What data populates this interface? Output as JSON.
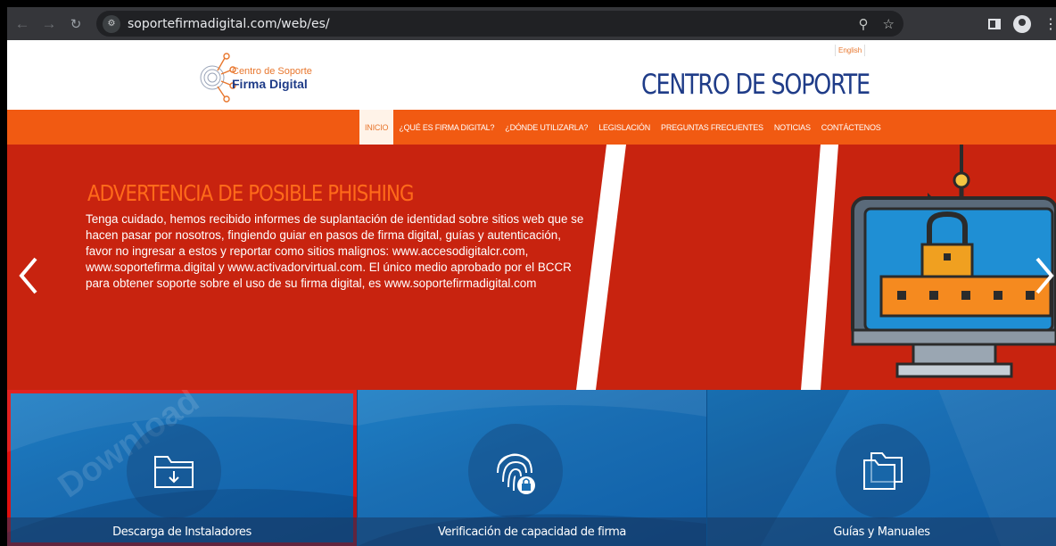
{
  "browser": {
    "url": "soportefirmadigital.com/web/es/",
    "icons": [
      "back-icon",
      "forward-icon",
      "reload-icon",
      "site-info-icon",
      "zoom-icon",
      "bookmark-star-icon",
      "side-panel-icon",
      "profile-icon",
      "menu-icon"
    ]
  },
  "header": {
    "logo_line1": "Centro de Soporte",
    "logo_line2": "Firma Digital",
    "lang_link": "English",
    "title": "CENTRO DE SOPORTE"
  },
  "nav": {
    "items": [
      {
        "label": "INICIO",
        "active": true
      },
      {
        "label": "¿QUÉ ES FIRMA DIGITAL?",
        "active": false
      },
      {
        "label": "¿DÓNDE UTILIZARLA?",
        "active": false
      },
      {
        "label": "LEGISLACIÓN",
        "active": false
      },
      {
        "label": "PREGUNTAS FRECUENTES",
        "active": false
      },
      {
        "label": "NOTICIAS",
        "active": false
      },
      {
        "label": "CONTÁCTENOS",
        "active": false
      }
    ]
  },
  "hero": {
    "title": "ADVERTENCIA DE POSIBLE PHISHING",
    "body": "Tenga cuidado, hemos recibido informes de suplantación de identidad sobre sitios web que se hacen pasar por nosotros, fingiendo guiar en pasos de firma digital, guías y autenticación, favor no ingresar a estos y reportar como sitios malignos: www.accesodigitalcr.com, www.soportefirma.digital y www.activadorvirtual.com. El único medio aprobado por el BCCR para obtener soporte sobre el uso de su firma digital, es www.soportefirmadigital.com"
  },
  "tiles": [
    {
      "label": "Descarga de Instaladores",
      "icon": "download-folder-icon",
      "watermark": "Download",
      "highlighted": true
    },
    {
      "label": "Verificación de capacidad de firma",
      "icon": "fingerprint-lock-icon",
      "highlighted": false
    },
    {
      "label": "Guías y Manuales",
      "icon": "folders-icon",
      "highlighted": false
    }
  ],
  "colors": {
    "nav_orange": "#f15a12",
    "hero_red": "#c8230f",
    "title_blue": "#1f3c88",
    "tile_blue": "#1a6eb3",
    "highlight_red": "#e01010"
  }
}
